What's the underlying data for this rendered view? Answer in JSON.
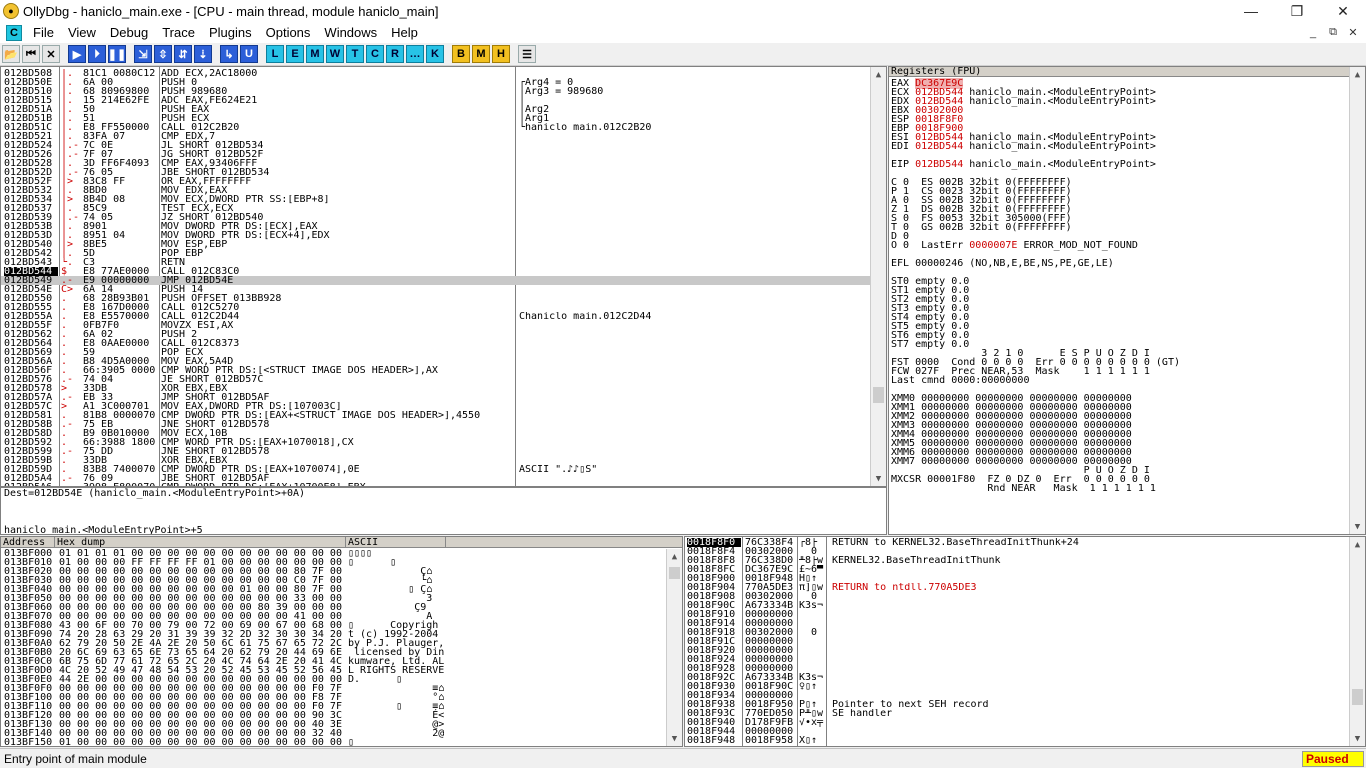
{
  "window": {
    "title": "OllyDbg - haniclo_main.exe - [CPU - main thread, module haniclo_main]",
    "min": "—",
    "max": "❐",
    "close": "✕"
  },
  "menu": {
    "badge": "C",
    "items": [
      "File",
      "View",
      "Debug",
      "Trace",
      "Plugins",
      "Options",
      "Windows",
      "Help"
    ],
    "mdi": [
      "_",
      "⧉",
      "✕"
    ]
  },
  "toolbar": {
    "buttons": [
      "📂",
      "⏮",
      "✕",
      "▶",
      "⏵",
      "❚❚",
      "⇲",
      "⇳",
      "⇵",
      "⇣",
      "↳",
      "U",
      "L",
      "E",
      "M",
      "W",
      "T",
      "C",
      "R",
      "…",
      "K",
      "B",
      "M",
      "H",
      "☰"
    ]
  },
  "disasm": {
    "rows": [
      {
        "a": "012BD508",
        "m": "|.",
        "h": "81C1 0080C12",
        "s": "ADD ECX,2AC18000",
        "c": "",
        "cr": false
      },
      {
        "a": "012BD50E",
        "m": "|.",
        "h": "6A 00",
        "s": "PUSH 0",
        "c": "┌Arg4 = 0",
        "cr": false
      },
      {
        "a": "012BD510",
        "m": "|.",
        "h": "68 80969800",
        "s": "PUSH 989680",
        "c": "│Arg3 = 989680",
        "cr": false
      },
      {
        "a": "012BD515",
        "m": "|.",
        "h": "15 214E62FE",
        "s": "ADC EAX,FE624E21",
        "c": "│",
        "cr": false
      },
      {
        "a": "012BD51A",
        "m": "|.",
        "h": "50",
        "s": "PUSH EAX",
        "c": "│Arg2",
        "cr": false
      },
      {
        "a": "012BD51B",
        "m": "|.",
        "h": "51",
        "s": "PUSH ECX",
        "c": "│Arg1",
        "cr": false
      },
      {
        "a": "012BD51C",
        "m": "|.",
        "h": "E8 FF550000",
        "s": "CALL 012C2B20",
        "c": "└haniclo_main.012C2B20",
        "cr": true
      },
      {
        "a": "012BD521",
        "m": "|.",
        "h": "83FA 07",
        "s": "CMP EDX,7",
        "c": "",
        "cr": false
      },
      {
        "a": "012BD524",
        "m": "|.-",
        "h": "7C 0E",
        "s": "JL SHORT 012BD534",
        "c": "",
        "cr": false
      },
      {
        "a": "012BD526",
        "m": "|.-",
        "h": "7F 07",
        "s": "JG SHORT 012BD52F",
        "c": "",
        "cr": false
      },
      {
        "a": "012BD528",
        "m": "|.",
        "h": "3D FF6F4093",
        "s": "CMP EAX,93406FFF",
        "c": "",
        "cr": false
      },
      {
        "a": "012BD52D",
        "m": "|.-",
        "h": "76 05",
        "s": "JBE SHORT 012BD534",
        "c": "",
        "cr": false
      },
      {
        "a": "012BD52F",
        "m": "|>",
        "h": "83C8 FF",
        "s": "OR EAX,FFFFFFFF",
        "c": "",
        "cr": false
      },
      {
        "a": "012BD532",
        "m": "|.",
        "h": "8BD0",
        "s": "MOV EDX,EAX",
        "c": "",
        "cr": false
      },
      {
        "a": "012BD534",
        "m": "|>",
        "h": "8B4D 08",
        "s": "MOV ECX,DWORD PTR SS:[EBP+8]",
        "c": "",
        "cr": false
      },
      {
        "a": "012BD537",
        "m": "|.",
        "h": "85C9",
        "s": "TEST ECX,ECX",
        "c": "",
        "cr": false
      },
      {
        "a": "012BD539",
        "m": "|.-",
        "h": "74 05",
        "s": "JZ SHORT 012BD540",
        "c": "",
        "cr": false
      },
      {
        "a": "012BD53B",
        "m": "|.",
        "h": "8901",
        "s": "MOV DWORD PTR DS:[ECX],EAX",
        "c": "",
        "cr": false
      },
      {
        "a": "012BD53D",
        "m": "|.",
        "h": "8951 04",
        "s": "MOV DWORD PTR DS:[ECX+4],EDX",
        "c": "",
        "cr": false
      },
      {
        "a": "012BD540",
        "m": "|>",
        "h": "8BE5",
        "s": "MOV ESP,EBP",
        "c": "",
        "cr": false
      },
      {
        "a": "012BD542",
        "m": "|.",
        "h": "5D",
        "s": "POP EBP",
        "c": "",
        "cr": false
      },
      {
        "a": "012BD543",
        "m": "└.",
        "h": "C3",
        "s": "RETN",
        "c": "",
        "cr": false
      },
      {
        "a": "012BD544",
        "m": "$",
        "h": "E8 77AE0000",
        "s": "CALL 012C83C0",
        "c": "",
        "cr": false,
        "sel": true
      },
      {
        "a": "012BD549",
        "m": ".-",
        "h": "E9 00000000",
        "s": "JMP 012BD54E",
        "c": "",
        "cr": false,
        "hl": true
      },
      {
        "a": "012BD54E",
        "m": "C>",
        "h": "6A 14",
        "s": "PUSH 14",
        "c": "",
        "cr": false
      },
      {
        "a": "012BD550",
        "m": ".",
        "h": "68 28B93B01",
        "s": "PUSH OFFSET 013BB928",
        "c": "",
        "cr": false
      },
      {
        "a": "012BD555",
        "m": ".",
        "h": "E8 167D0000",
        "s": "CALL 012C5270",
        "c": "",
        "cr": false
      },
      {
        "a": "012BD55A",
        "m": ".",
        "h": "E8 E5570000",
        "s": "CALL 012C2D44",
        "c": "Chaniclo_main.012C2D44",
        "cr": true
      },
      {
        "a": "012BD55F",
        "m": ".",
        "h": "0FB7F0",
        "s": "MOVZX ESI,AX",
        "c": "",
        "cr": false
      },
      {
        "a": "012BD562",
        "m": ".",
        "h": "6A 02",
        "s": "PUSH 2",
        "c": "",
        "cr": false
      },
      {
        "a": "012BD564",
        "m": ".",
        "h": "E8 0AAE0000",
        "s": "CALL 012C8373",
        "c": "",
        "cr": false
      },
      {
        "a": "012BD569",
        "m": ".",
        "h": "59",
        "s": "POP ECX",
        "c": "",
        "cr": false
      },
      {
        "a": "012BD56A",
        "m": ".",
        "h": "B8 4D5A0000",
        "s": "MOV EAX,5A4D",
        "c": "",
        "cr": false
      },
      {
        "a": "012BD56F",
        "m": ".",
        "h": "66:3905 0000",
        "s": "CMP WORD PTR DS:[<STRUCT IMAGE_DOS_HEADER>],AX",
        "c": "",
        "cr": false
      },
      {
        "a": "012BD576",
        "m": ".-",
        "h": "74 04",
        "s": "JE SHORT 012BD57C",
        "c": "",
        "cr": false
      },
      {
        "a": "012BD578",
        "m": ">",
        "h": "33DB",
        "s": "XOR EBX,EBX",
        "c": "",
        "cr": false
      },
      {
        "a": "012BD57A",
        "m": ".-",
        "h": "EB 33",
        "s": "JMP SHORT 012BD5AF",
        "c": "",
        "cr": false
      },
      {
        "a": "012BD57C",
        "m": ">",
        "h": "A1 3C000701",
        "s": "MOV EAX,DWORD PTR DS:[107003C]",
        "c": "",
        "cr": false
      },
      {
        "a": "012BD581",
        "m": ".",
        "h": "81B8 0000070",
        "s": "CMP DWORD PTR DS:[EAX+<STRUCT IMAGE_DOS_HEADER>],4550",
        "c": "",
        "cr": false
      },
      {
        "a": "012BD58B",
        "m": ".-",
        "h": "75 EB",
        "s": "JNE SHORT 012BD578",
        "c": "",
        "cr": false
      },
      {
        "a": "012BD58D",
        "m": ".",
        "h": "B9 0B010000",
        "s": "MOV ECX,10B",
        "c": "",
        "cr": false
      },
      {
        "a": "012BD592",
        "m": ".",
        "h": "66:3988 1800",
        "s": "CMP WORD PTR DS:[EAX+1070018],CX",
        "c": "",
        "cr": false
      },
      {
        "a": "012BD599",
        "m": ".-",
        "h": "75 DD",
        "s": "JNE SHORT 012BD578",
        "c": "",
        "cr": false
      },
      {
        "a": "012BD59B",
        "m": ".",
        "h": "33DB",
        "s": "XOR EBX,EBX",
        "c": "",
        "cr": false
      },
      {
        "a": "012BD59D",
        "m": ".",
        "h": "83B8 7400070",
        "s": "CMP DWORD PTR DS:[EAX+1070074],0E",
        "c": "ASCII \".♪♪▯S\"",
        "cr": false
      },
      {
        "a": "012BD5A4",
        "m": ".-",
        "h": "76 09",
        "s": "JBE SHORT 012BD5AF",
        "c": "",
        "cr": false
      },
      {
        "a": "012BD5A6",
        "m": ".",
        "h": "3998 E800070",
        "s": "CMP DWORD PTR DS:[EAX+10700E8],EBX",
        "c": "",
        "cr": false
      }
    ]
  },
  "info": {
    "l1": "Dest=012BD54E (haniclo_main.<ModuleEntryPoint>+0A)",
    "l2": "haniclo_main.<ModuleEntryPoint>+5"
  },
  "registers": {
    "header": "Registers (FPU)",
    "lines": [
      {
        "t": "EAX ",
        "v": "DC367E9C",
        "r": "",
        "hlv": true
      },
      {
        "t": "ECX ",
        "v": "012BD544",
        "r": " haniclo_main.<ModuleEntryPoint>"
      },
      {
        "t": "EDX ",
        "v": "012BD544",
        "r": " haniclo_main.<ModuleEntryPoint>"
      },
      {
        "t": "EBX ",
        "v": "00302000",
        "r": ""
      },
      {
        "t": "ESP ",
        "v": "0018F8F0",
        "r": ""
      },
      {
        "t": "EBP ",
        "v": "0018F900",
        "r": ""
      },
      {
        "t": "ESI ",
        "v": "012BD544",
        "r": " haniclo_main.<ModuleEntryPoint>"
      },
      {
        "t": "EDI ",
        "v": "012BD544",
        "r": " haniclo_main.<ModuleEntryPoint>"
      },
      {
        "t": "",
        "v": "",
        "r": ""
      },
      {
        "t": "EIP ",
        "v": "012BD544",
        "r": " haniclo_main.<ModuleEntryPoint>"
      },
      {
        "t": "",
        "v": "",
        "r": ""
      },
      {
        "t": "C 0  ES 002B 32bit 0(FFFFFFFF)",
        "v": "",
        "r": ""
      },
      {
        "t": "P 1  CS 0023 32bit 0(FFFFFFFF)",
        "v": "",
        "r": ""
      },
      {
        "t": "A 0  SS 002B 32bit 0(FFFFFFFF)",
        "v": "",
        "r": ""
      },
      {
        "t": "Z 1  DS 002B 32bit 0(FFFFFFFF)",
        "v": "",
        "r": ""
      },
      {
        "t": "S 0  FS 0053 32bit 305000(FFF)",
        "v": "",
        "r": ""
      },
      {
        "t": "T 0  GS 002B 32bit 0(FFFFFFFF)",
        "v": "",
        "r": ""
      },
      {
        "t": "D 0",
        "v": "",
        "r": ""
      },
      {
        "t": "O 0  LastErr ",
        "v": "0000007E",
        "r": " ERROR_MOD_NOT_FOUND"
      },
      {
        "t": "",
        "v": "",
        "r": ""
      },
      {
        "t": "EFL 00000246 (NO,NB,E,BE,NS,PE,GE,LE)",
        "v": "",
        "r": ""
      },
      {
        "t": "",
        "v": "",
        "r": ""
      },
      {
        "t": "ST0 empty 0.0",
        "v": "",
        "r": ""
      },
      {
        "t": "ST1 empty 0.0",
        "v": "",
        "r": ""
      },
      {
        "t": "ST2 empty 0.0",
        "v": "",
        "r": ""
      },
      {
        "t": "ST3 empty 0.0",
        "v": "",
        "r": ""
      },
      {
        "t": "ST4 empty 0.0",
        "v": "",
        "r": ""
      },
      {
        "t": "ST5 empty 0.0",
        "v": "",
        "r": ""
      },
      {
        "t": "ST6 empty 0.0",
        "v": "",
        "r": ""
      },
      {
        "t": "ST7 empty 0.0",
        "v": "",
        "r": ""
      },
      {
        "t": "               3 2 1 0      E S P U O Z D I",
        "v": "",
        "r": ""
      },
      {
        "t": "FST 0000  Cond 0 0 0 0  Err 0 0 0 0 0 0 0 0 (GT)",
        "v": "",
        "r": ""
      },
      {
        "t": "FCW 027F  Prec NEAR,53  Mask    1 1 1 1 1 1",
        "v": "",
        "r": ""
      },
      {
        "t": "Last cmnd 0000:00000000",
        "v": "",
        "r": ""
      },
      {
        "t": "",
        "v": "",
        "r": ""
      },
      {
        "t": "XMM0 00000000 00000000 00000000 00000000",
        "v": "",
        "r": ""
      },
      {
        "t": "XMM1 00000000 00000000 00000000 00000000",
        "v": "",
        "r": ""
      },
      {
        "t": "XMM2 00000000 00000000 00000000 00000000",
        "v": "",
        "r": ""
      },
      {
        "t": "XMM3 00000000 00000000 00000000 00000000",
        "v": "",
        "r": ""
      },
      {
        "t": "XMM4 00000000 00000000 00000000 00000000",
        "v": "",
        "r": ""
      },
      {
        "t": "XMM5 00000000 00000000 00000000 00000000",
        "v": "",
        "r": ""
      },
      {
        "t": "XMM6 00000000 00000000 00000000 00000000",
        "v": "",
        "r": ""
      },
      {
        "t": "XMM7 00000000 00000000 00000000 00000000",
        "v": "",
        "r": ""
      },
      {
        "t": "                                P U O Z D I",
        "v": "",
        "r": ""
      },
      {
        "t": "MXCSR 00001F80  FZ 0 DZ 0  Err  0 0 0 0 0 0",
        "v": "",
        "r": ""
      },
      {
        "t": "                Rnd NEAR   Mask  1 1 1 1 1 1",
        "v": "",
        "r": ""
      }
    ]
  },
  "dump": {
    "headers": [
      "Address",
      "Hex dump",
      "ASCII"
    ],
    "rows": [
      {
        "a": "013BF000",
        "h": "01 01 01 01 00 00 00 00 00 00 00 00 00 00 00 00",
        "s": "▯▯▯▯"
      },
      {
        "a": "013BF010",
        "h": "01 00 00 00 FF FF FF FF 01 00 00 00 00 00 00 00",
        "s": "▯      ▯"
      },
      {
        "a": "013BF020",
        "h": "00 00 00 00 00 00 00 00 00 00 00 00 00 80 7F 00",
        "s": "            Ç⌂"
      },
      {
        "a": "013BF030",
        "h": "00 00 00 00 00 00 00 00 00 00 00 00 00 C0 7F 00",
        "s": "            └⌂"
      },
      {
        "a": "013BF040",
        "h": "00 00 00 00 00 00 00 00 00 00 01 00 00 80 7F 00",
        "s": "          ▯ Ç⌂"
      },
      {
        "a": "013BF050",
        "h": "00 00 00 00 00 00 00 00 00 00 00 00 00 33 00 00",
        "s": "             3"
      },
      {
        "a": "013BF060",
        "h": "00 00 00 00 00 00 00 00 00 00 00 80 39 00 00 00",
        "s": "           Ç9"
      },
      {
        "a": "013BF070",
        "h": "00 00 00 00 00 00 00 00 00 00 00 00 00 41 00 00",
        "s": "             A"
      },
      {
        "a": "013BF080",
        "h": "43 00 6F 00 70 00 79 00 72 00 69 00 67 00 68 00",
        "s": "▯      Copyrigh"
      },
      {
        "a": "013BF090",
        "h": "74 20 28 63 29 20 31 39 39 32 2D 32 30 30 34 20",
        "s": "t (c) 1992-2004 "
      },
      {
        "a": "013BF0A0",
        "h": "62 79 20 50 2E 4A 2E 20 50 6C 61 75 67 65 72 2C",
        "s": "by P.J. Plauger,"
      },
      {
        "a": "013BF0B0",
        "h": "20 6C 69 63 65 6E 73 65 64 20 62 79 20 44 69 6E",
        "s": " licensed by Din"
      },
      {
        "a": "013BF0C0",
        "h": "6B 75 6D 77 61 72 65 2C 20 4C 74 64 2E 20 41 4C",
        "s": "kumware, Ltd. AL"
      },
      {
        "a": "013BF0D0",
        "h": "4C 20 52 49 47 48 54 53 20 52 45 53 45 52 56 45",
        "s": "L RIGHTS RESERVE"
      },
      {
        "a": "013BF0E0",
        "h": "44 2E 00 00 00 00 00 00 00 00 00 00 00 00 00 00",
        "s": "D.      ▯"
      },
      {
        "a": "013BF0F0",
        "h": "00 00 00 00 00 00 00 00 00 00 00 00 00 00 F0 7F",
        "s": "              ≡⌂"
      },
      {
        "a": "013BF100",
        "h": "00 00 00 00 00 00 00 00 00 00 00 00 00 00 F8 7F",
        "s": "              °⌂"
      },
      {
        "a": "013BF110",
        "h": "00 00 00 00 00 00 00 00 00 00 00 00 00 00 F0 7F",
        "s": "        ▯     ≡⌂"
      },
      {
        "a": "013BF120",
        "h": "00 00 00 00 00 00 00 00 00 00 00 00 00 00 90 3C",
        "s": "              É<"
      },
      {
        "a": "013BF130",
        "h": "00 00 00 00 00 00 00 00 00 00 00 00 00 00 40 3E",
        "s": "              @>"
      },
      {
        "a": "013BF140",
        "h": "00 00 00 00 00 00 00 00 00 00 00 00 00 00 32 40",
        "s": "              2@"
      },
      {
        "a": "013BF150",
        "h": "01 00 00 00 00 00 00 00 00 00 00 00 00 00 00 00",
        "s": "▯"
      }
    ]
  },
  "stack": {
    "rows": [
      {
        "a": "0018F8F0",
        "v": "76C338F4",
        "s": "┌8├",
        "c": "RETURN to KERNEL32.BaseThreadInitThunk+24",
        "sel": true,
        "cr": false
      },
      {
        "a": "0018F8F4",
        "v": "00302000",
        "s": "  0",
        "c": "",
        "cr": false
      },
      {
        "a": "0018F8F8",
        "v": "76C338D0",
        "s": "╨8├w",
        "c": "KERNEL32.BaseThreadInitThunk",
        "cr": false
      },
      {
        "a": "0018F8FC",
        "v": "DC367E9C",
        "s": "£~6▀",
        "c": "",
        "cr": false
      },
      {
        "a": "0018F900",
        "v": "0018F948",
        "s": "H▯↑",
        "c": "",
        "cr": false
      },
      {
        "a": "0018F904",
        "v": "770A5DE3",
        "s": "π]▯w",
        "c": "RETURN to ntdll.770A5DE3",
        "cr": true
      },
      {
        "a": "0018F908",
        "v": "00302000",
        "s": "  0",
        "c": "",
        "cr": false
      },
      {
        "a": "0018F90C",
        "v": "A673334B",
        "s": "K3s¬",
        "c": "",
        "cr": false
      },
      {
        "a": "0018F910",
        "v": "00000000",
        "s": "",
        "c": "",
        "cr": false
      },
      {
        "a": "0018F914",
        "v": "00000000",
        "s": "",
        "c": "",
        "cr": false
      },
      {
        "a": "0018F918",
        "v": "00302000",
        "s": "  0",
        "c": "",
        "cr": false
      },
      {
        "a": "0018F91C",
        "v": "00000000",
        "s": "",
        "c": "",
        "cr": false
      },
      {
        "a": "0018F920",
        "v": "00000000",
        "s": "",
        "c": "",
        "cr": false
      },
      {
        "a": "0018F924",
        "v": "00000000",
        "s": "",
        "c": "",
        "cr": false
      },
      {
        "a": "0018F928",
        "v": "00000000",
        "s": "",
        "c": "",
        "cr": false
      },
      {
        "a": "0018F92C",
        "v": "A673334B",
        "s": "K3s¬",
        "c": "",
        "cr": false
      },
      {
        "a": "0018F930",
        "v": "0018F90C",
        "s": "♀▯↑",
        "c": "",
        "cr": false
      },
      {
        "a": "0018F934",
        "v": "00000000",
        "s": "",
        "c": "",
        "cr": false
      },
      {
        "a": "0018F938",
        "v": "0018F950",
        "s": "P▯↑",
        "c": "Pointer to next SEH record",
        "cr": false
      },
      {
        "a": "0018F93C",
        "v": "770ED050",
        "s": "P╨▯w",
        "c": "SE handler",
        "cr": false
      },
      {
        "a": "0018F940",
        "v": "D178F9FB",
        "s": "√∙x╤",
        "c": "",
        "cr": false
      },
      {
        "a": "0018F944",
        "v": "00000000",
        "s": "",
        "c": "",
        "cr": false
      },
      {
        "a": "0018F948",
        "v": "0018F958",
        "s": "X▯↑",
        "c": "",
        "cr": false
      }
    ]
  },
  "status": {
    "message": "Entry point of main module",
    "state": "Paused"
  }
}
